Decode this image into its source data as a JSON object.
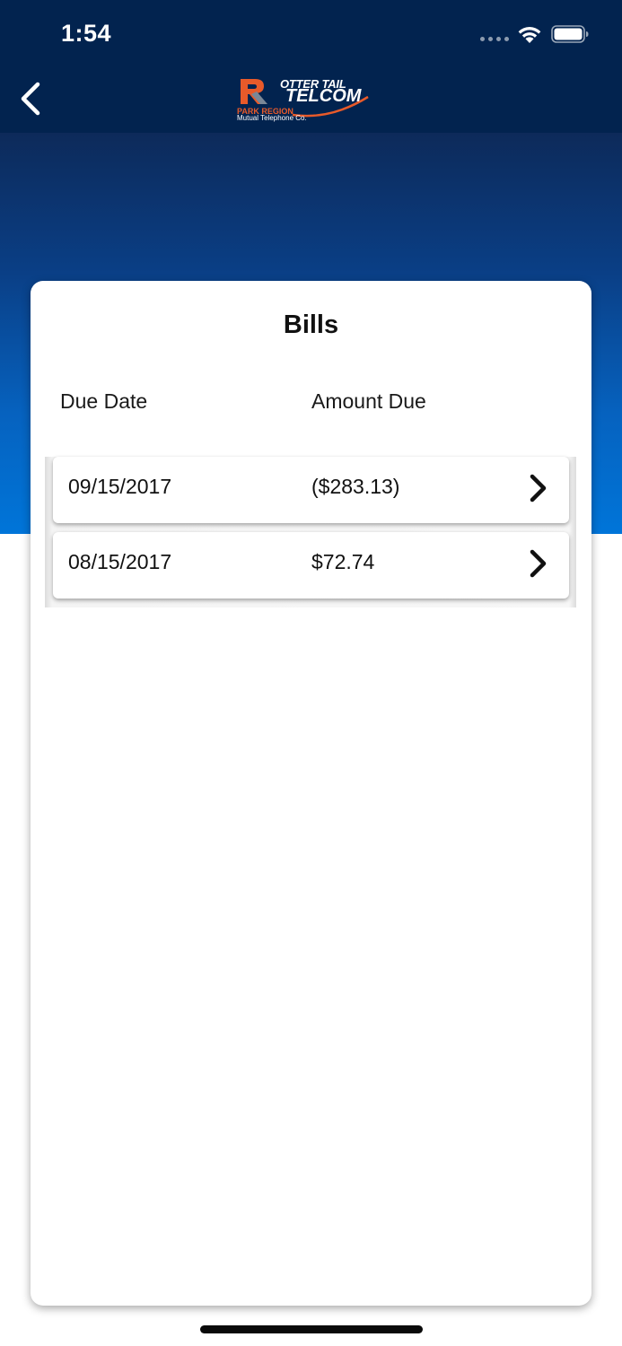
{
  "status_bar": {
    "time": "1:54"
  },
  "nav": {
    "back_icon": "chevron-left-icon",
    "logo": {
      "line1": "OTTER TAIL",
      "line2": "TELCOM",
      "line3": "PARK REGION",
      "line4": "Mutual Telephone Co."
    }
  },
  "card": {
    "title": "Bills",
    "headers": {
      "due_date": "Due Date",
      "amount_due": "Amount Due"
    },
    "bills": [
      {
        "due_date": "09/15/2017",
        "amount": "($283.13)"
      },
      {
        "due_date": "08/15/2017",
        "amount": "$72.74"
      }
    ]
  },
  "colors": {
    "nav_bg": "#02234f",
    "gradient_top": "#0d2a5a",
    "gradient_bottom": "#0075d9",
    "logo_accent": "#e85a2a"
  }
}
